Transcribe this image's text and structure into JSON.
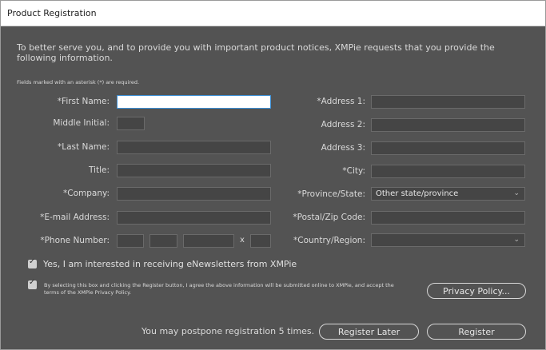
{
  "window": {
    "title": "Product Registration"
  },
  "intro": "To better serve you, and to provide you with important product notices, XMPie requests that you provide the following information.",
  "required_note": "Fields marked with an asterisk (*) are required.",
  "left_fields": [
    {
      "label": "*First Name:",
      "value": ""
    },
    {
      "label": "Middle Initial:",
      "value": ""
    },
    {
      "label": "*Last Name:",
      "value": ""
    },
    {
      "label": "Title:",
      "value": ""
    },
    {
      "label": "*Company:",
      "value": ""
    },
    {
      "label": "*E-mail Address:",
      "value": ""
    },
    {
      "label": "*Phone Number:",
      "value": ""
    }
  ],
  "right_fields": [
    {
      "label": "*Address 1:",
      "value": ""
    },
    {
      "label": "Address 2:",
      "value": ""
    },
    {
      "label": "Address 3:",
      "value": ""
    },
    {
      "label": "*City:",
      "value": ""
    },
    {
      "label": "*Province/State:",
      "value": "Other state/province"
    },
    {
      "label": "*Postal/Zip Code:",
      "value": ""
    },
    {
      "label": "*Country/Region:",
      "value": ""
    }
  ],
  "phone_ext_separator": "x",
  "newsletter_label": "Yes, I am interested in receiving eNewsletters from XMPie",
  "agree_text": "By selecting this box and clicking the Register button, I agree the above information will be submitted online to XMPie, and accept the terms of the XMPie Privacy Policy.",
  "privacy_button": "Privacy Policy...",
  "postpone_text": "You may postpone registration 5 times.",
  "register_later_button": "Register Later",
  "register_button": "Register",
  "icons": {
    "checkbox_checked": "check-icon",
    "dropdown": "chevron-down-icon"
  }
}
